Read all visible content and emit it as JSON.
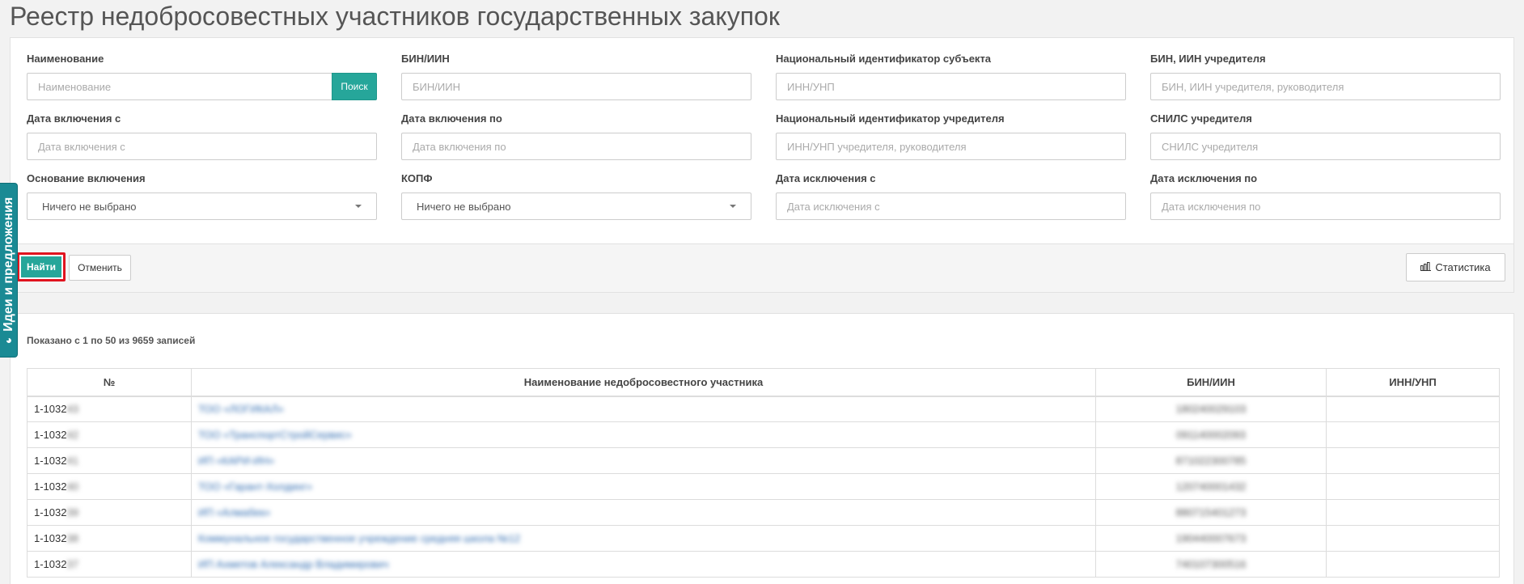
{
  "page": {
    "title": "Реестр недобросовестных участников государственных закупок"
  },
  "side_tab": {
    "label": "Идеи и предложения"
  },
  "filters": {
    "row1": [
      {
        "label": "Наименование",
        "placeholder": "Наименование",
        "button": "Поиск"
      },
      {
        "label": "БИН/ИИН",
        "placeholder": "БИН/ИИН"
      },
      {
        "label": "Национальный идентификатор субъекта",
        "placeholder": "ИНН/УНП"
      },
      {
        "label": "БИН, ИИН учредителя",
        "placeholder": "БИН, ИИН учредителя, руководителя"
      }
    ],
    "row2": [
      {
        "label": "Дата включения с",
        "placeholder": "Дата включения с"
      },
      {
        "label": "Дата включения по",
        "placeholder": "Дата включения по"
      },
      {
        "label": "Национальный идентификатор учредителя",
        "placeholder": "ИНН/УНП учредителя, руководителя"
      },
      {
        "label": "СНИЛС учредителя",
        "placeholder": "СНИЛС учредителя"
      }
    ],
    "row3": [
      {
        "label": "Основание включения",
        "selected": "Ничего не выбрано"
      },
      {
        "label": "КОПФ",
        "selected": "Ничего не выбрано"
      },
      {
        "label": "Дата исключения с",
        "placeholder": "Дата исключения с"
      },
      {
        "label": "Дата исключения по",
        "placeholder": "Дата исключения по"
      }
    ]
  },
  "actions": {
    "find": "Найти",
    "cancel": "Отменить",
    "statistics": "Статистика"
  },
  "results": {
    "info": "Показано с 1 по 50 из 9659 записей",
    "columns": [
      "№",
      "Наименование недобросовестного участника",
      "БИН/ИИН",
      "ИНН/УНП"
    ],
    "rows": [
      {
        "num": "1-1032",
        "num_hidden": "43",
        "name": "ТОО «ЛОГИКАЛ»",
        "bin": "180240029103",
        "inn": ""
      },
      {
        "num": "1-1032",
        "num_hidden": "42",
        "name": "ТОО «ТранспортСтройСервис»",
        "bin": "091140002093",
        "inn": ""
      },
      {
        "num": "1-1032",
        "num_hidden": "41",
        "name": "ИП «КАРИ-ИН»",
        "bin": "871022300785",
        "inn": ""
      },
      {
        "num": "1-1032",
        "num_hidden": "40",
        "name": "ТОО «Гарант-Холдинг»",
        "bin": "120740001432",
        "inn": ""
      },
      {
        "num": "1-1032",
        "num_hidden": "39",
        "name": "ИП «Алмабек»",
        "bin": "880715401273",
        "inn": ""
      },
      {
        "num": "1-1032",
        "num_hidden": "38",
        "name": "Коммунальное государственное учреждение средняя школа №12",
        "bin": "190440007673",
        "inn": ""
      },
      {
        "num": "1-1032",
        "num_hidden": "37",
        "name": "ИП Ахметов Александр Владимирович",
        "bin": "740107300516",
        "inn": ""
      }
    ]
  }
}
